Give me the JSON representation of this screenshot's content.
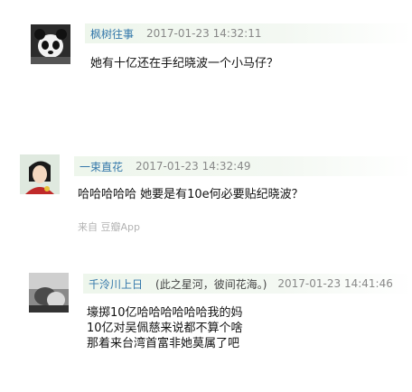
{
  "comments": [
    {
      "user": "枫树往事",
      "time": "2017-01-23 14:32:11",
      "lines": [
        "她有十亿还在手纪晓波一个小马仔？"
      ]
    },
    {
      "user": "一束直花",
      "time": "2017-01-23 14:32:49",
      "lines": [
        "哈哈哈哈哈 她要是有10e何必要贴纪晓波？"
      ],
      "source": "来自 豆瓣App"
    },
    {
      "user": "千泠川上日",
      "signature": "(此之星河，彼间花海。)",
      "time": "2017-01-23 14:41:46",
      "lines": [
        "壕掷10亿哈哈哈哈哈哈我的妈",
        "10亿对吴佩慈来说都不算个啥",
        "那着来台湾首富非她莫属了吧"
      ]
    }
  ]
}
